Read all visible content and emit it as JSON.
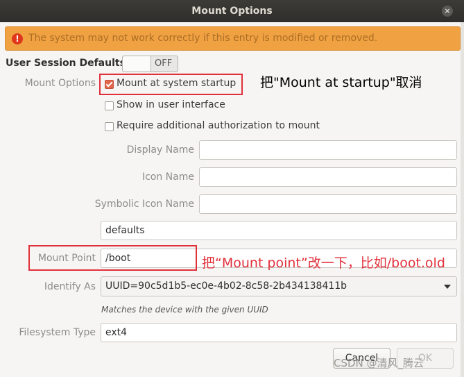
{
  "window": {
    "title": "Mount Options",
    "close_glyph": "×"
  },
  "warning": {
    "icon_glyph": "!",
    "text": "The system may not work correctly if this entry is modified or removed."
  },
  "user_session": {
    "label": "User Session Defaults",
    "toggle_text": "OFF"
  },
  "mount_options": {
    "label": "Mount Options",
    "options": [
      {
        "label": "Mount at system startup",
        "checked": true
      },
      {
        "label": "Show in user interface",
        "checked": false
      },
      {
        "label": "Require additional authorization to mount",
        "checked": false
      }
    ]
  },
  "fields": {
    "display_name": {
      "label": "Display Name",
      "value": ""
    },
    "icon_name": {
      "label": "Icon Name",
      "value": ""
    },
    "symbolic_icon_name": {
      "label": "Symbolic Icon Name",
      "value": ""
    },
    "options_value": "defaults",
    "mount_point": {
      "label": "Mount Point",
      "value": "/boot"
    },
    "identify_as": {
      "label": "Identify As",
      "value": "UUID=90c5d1b5-ec0e-4b02-8c58-2b434138411b",
      "hint": "Matches the device with the given UUID"
    },
    "filesystem_type": {
      "label": "Filesystem Type",
      "value": "ext4"
    }
  },
  "annotations": {
    "startup": "把\"Mount at startup\"取消",
    "mount_point": "把“Mount point”改一下，比如/boot.old"
  },
  "buttons": {
    "cancel": "Cancel",
    "ok": "OK"
  },
  "watermark": "CSDN @清风_腾云",
  "colors": {
    "accent": "#e2674a",
    "warning": "#f0a142",
    "annotation_red": "#e0303a"
  }
}
